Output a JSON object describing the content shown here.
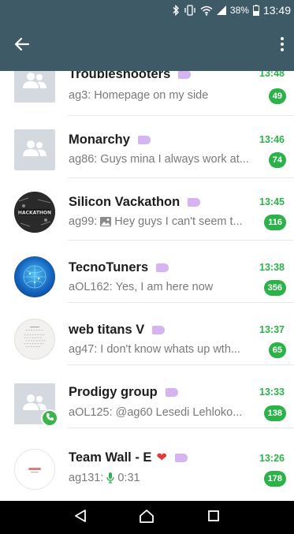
{
  "status_bar": {
    "battery": "38%",
    "time": "13:49"
  },
  "app_bar": {
    "back_icon": "arrow-left-icon",
    "menu_icon": "more-vert-icon"
  },
  "colors": {
    "primary": "#3f5a67",
    "accent_green": "#2bb34a",
    "tag_purple": "#d6b4f2"
  },
  "chats": [
    {
      "title": "Troubleshooters",
      "time": "13:48",
      "sender": "ag3:",
      "message": "Homepage on my side",
      "unread": "49",
      "avatar": "group-icon"
    },
    {
      "title": "Monarchy",
      "time": "13:46",
      "sender": "ag86:",
      "message": "Guys mina I always work at...",
      "unread": "74",
      "avatar": "group-icon"
    },
    {
      "title": "Silicon Vackathon",
      "time": "13:45",
      "sender": "ag99:",
      "message": "Hey guys I can't seem t...",
      "unread": "116",
      "avatar": "hackathon-image",
      "avatar_text": "HACKATHON"
    },
    {
      "title": "TecnoTuners",
      "time": "13:38",
      "sender": "aOL162:",
      "message": "Yes, I am here now",
      "unread": "356",
      "avatar": "tech-globe-image"
    },
    {
      "title": "web titans V",
      "time": "13:37",
      "sender": "ag47:",
      "message": "I don't know whats up wth...",
      "unread": "65",
      "avatar": "document-image"
    },
    {
      "title": "Prodigy group",
      "time": "13:33",
      "sender": "aOL125:",
      "message": "@ag60 Lesedi Lehloko...",
      "unread": "138",
      "avatar": "group-icon"
    },
    {
      "title": "Team Wall - E",
      "time": "13:26",
      "sender": "ag131:",
      "message": "0:31",
      "unread": "178",
      "avatar": "logo-image"
    }
  ],
  "nav": {
    "back": "nav-back-icon",
    "home": "nav-home-icon",
    "recents": "nav-recents-icon"
  }
}
